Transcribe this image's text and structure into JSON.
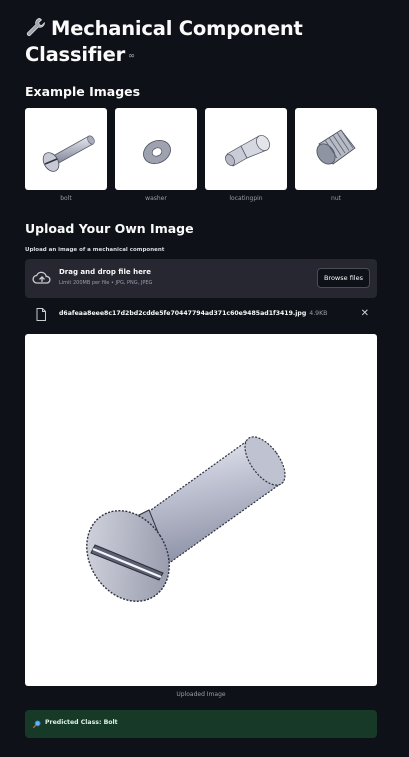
{
  "title": {
    "text": "Mechanical Component Classifier",
    "anchor": "∞"
  },
  "examples": {
    "heading": "Example Images",
    "items": [
      {
        "label": "bolt",
        "icon": "bolt-thumb-icon"
      },
      {
        "label": "washer",
        "icon": "washer-thumb-icon"
      },
      {
        "label": "locatingpin",
        "icon": "locatingpin-thumb-icon"
      },
      {
        "label": "nut",
        "icon": "nut-thumb-icon"
      }
    ]
  },
  "upload": {
    "heading": "Upload Your Own Image",
    "field_label": "Upload an image of a mechanical component",
    "dropzone_title": "Drag and drop file here",
    "dropzone_limit": "Limit 200MB per file • JPG, PNG, JPEG",
    "browse_label": "Browse files",
    "file_name": "d6afeaa8eee8c17d2bd2cdde5fe70447794ad371c60e9485ad1f3419.jpg",
    "file_size": "4.9KB",
    "close_glyph": "✕"
  },
  "preview": {
    "caption": "Uploaded Image"
  },
  "result": {
    "text": "Predicted Class: Bolt",
    "icon": "magnifier-icon"
  },
  "colors": {
    "background": "#0e1117",
    "panel": "#262730",
    "success_bg": "#173928",
    "text_muted": "#9a9ea6"
  }
}
